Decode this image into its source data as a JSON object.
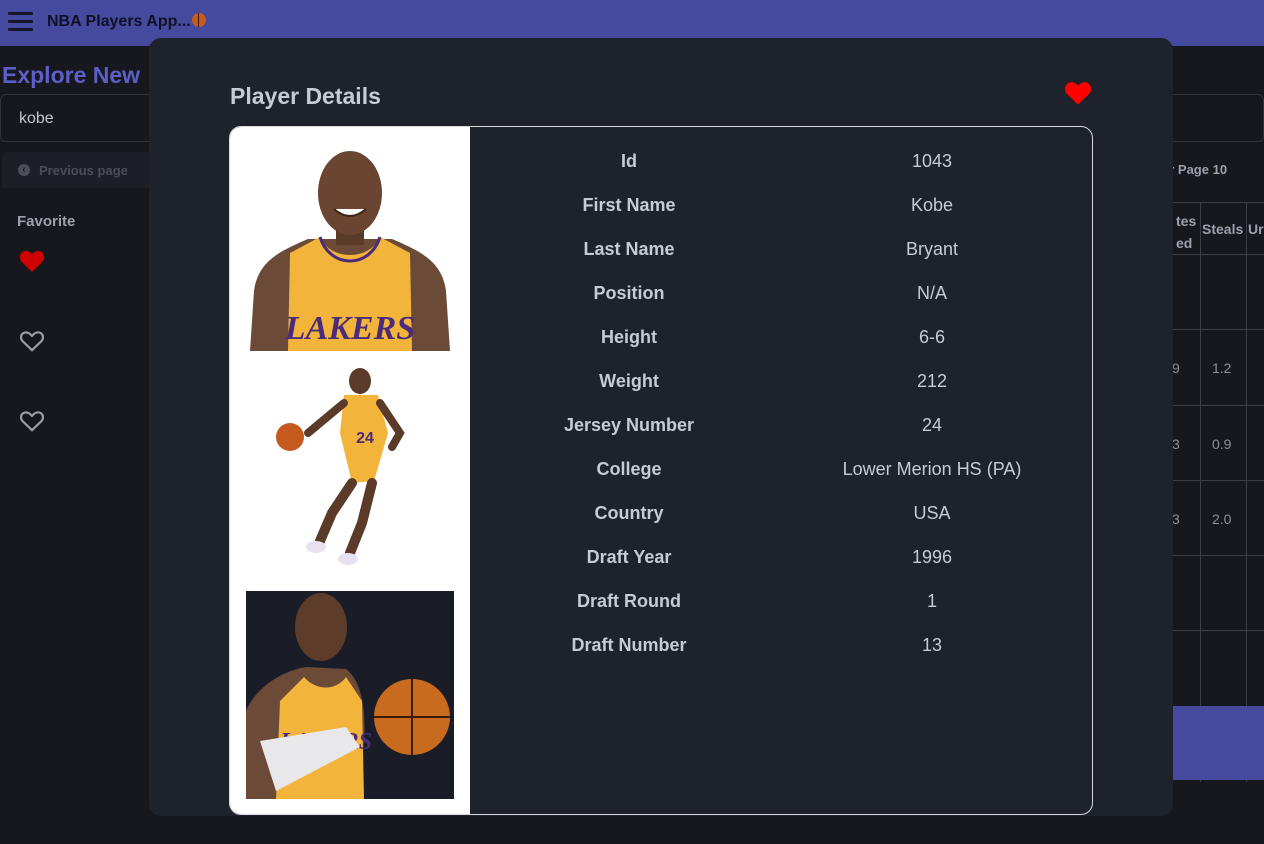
{
  "app": {
    "title": "NBA Players App..."
  },
  "background": {
    "heading": "Explore New",
    "search_value": "kobe",
    "previous_page": "Previous page",
    "favorite_label": "Favorite",
    "per_page": "er Page 10",
    "table": {
      "headers": [
        "tes\ned",
        "Steals",
        "Ur"
      ],
      "rows": [
        [
          "",
          ""
        ],
        [
          "9",
          "1.2"
        ],
        [
          "3",
          "0.9"
        ],
        [
          "3",
          "2.0"
        ],
        [
          "",
          ""
        ],
        [
          "",
          ""
        ]
      ]
    }
  },
  "modal": {
    "title": "Player Details",
    "favorite": true,
    "fields": [
      {
        "label": "Id",
        "value": "1043"
      },
      {
        "label": "First Name",
        "value": "Kobe"
      },
      {
        "label": "Last Name",
        "value": "Bryant"
      },
      {
        "label": "Position",
        "value": "N/A"
      },
      {
        "label": "Height",
        "value": "6-6"
      },
      {
        "label": "Weight",
        "value": "212"
      },
      {
        "label": "Jersey Number",
        "value": "24"
      },
      {
        "label": "College",
        "value": "Lower Merion HS (PA)"
      },
      {
        "label": "Country",
        "value": "USA"
      },
      {
        "label": "Draft Year",
        "value": "1996"
      },
      {
        "label": "Draft Round",
        "value": "1"
      },
      {
        "label": "Draft Number",
        "value": "13"
      }
    ]
  },
  "colors": {
    "accent": "#464a9e",
    "favorite": "#ff0000",
    "modal_bg": "#1e222a",
    "page_bg": "#16181d"
  }
}
